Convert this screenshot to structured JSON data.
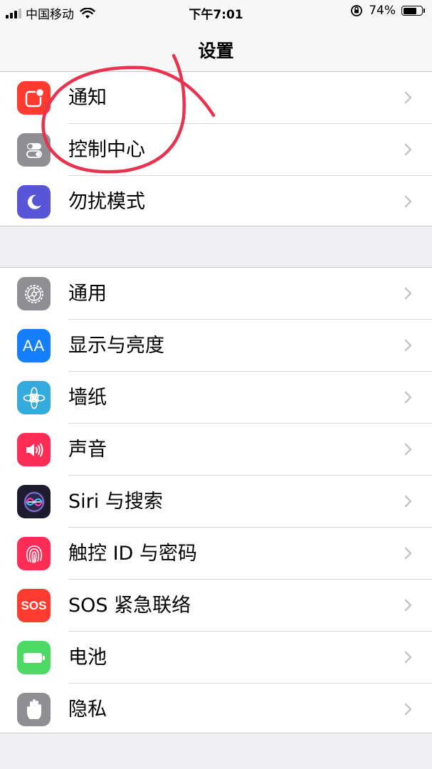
{
  "status_bar": {
    "carrier": "中国移动",
    "time": "下午7:01",
    "battery_percent_text": "74%",
    "battery_level": 0.74
  },
  "nav": {
    "title": "设置"
  },
  "groups": [
    {
      "rows": [
        {
          "label": "通知",
          "icon": "notifications-icon",
          "color": "#ff3b30"
        },
        {
          "label": "控制中心",
          "icon": "control-center-icon",
          "color": "#8e8e93"
        },
        {
          "label": "勿扰模式",
          "icon": "moon-icon",
          "color": "#5856d6"
        }
      ]
    },
    {
      "rows": [
        {
          "label": "通用",
          "icon": "gear-icon",
          "color": "#8e8e93"
        },
        {
          "label": "显示与亮度",
          "icon": "display-brightness-icon",
          "color": "#147efb",
          "icon_text": "AA"
        },
        {
          "label": "墙纸",
          "icon": "wallpaper-flower-icon",
          "color": "#35aadc"
        },
        {
          "label": "声音",
          "icon": "speaker-icon",
          "color": "#ff2d55"
        },
        {
          "label": "Siri 与搜索",
          "icon": "siri-icon",
          "color": "#1c1c2e"
        },
        {
          "label": "触控 ID 与密码",
          "icon": "fingerprint-icon",
          "color": "#ff2d55"
        },
        {
          "label": "SOS 紧急联络",
          "icon": "sos-icon",
          "color": "#ff3b30",
          "icon_text": "SOS"
        },
        {
          "label": "电池",
          "icon": "battery-icon",
          "color": "#4cd964"
        },
        {
          "label": "隐私",
          "icon": "privacy-hand-icon",
          "color": "#8e8e93"
        }
      ]
    }
  ],
  "annotation": {
    "color": "#e8334f",
    "shape": "hand-drawn-circle",
    "encircles": [
      "通知",
      "控制中心"
    ]
  }
}
